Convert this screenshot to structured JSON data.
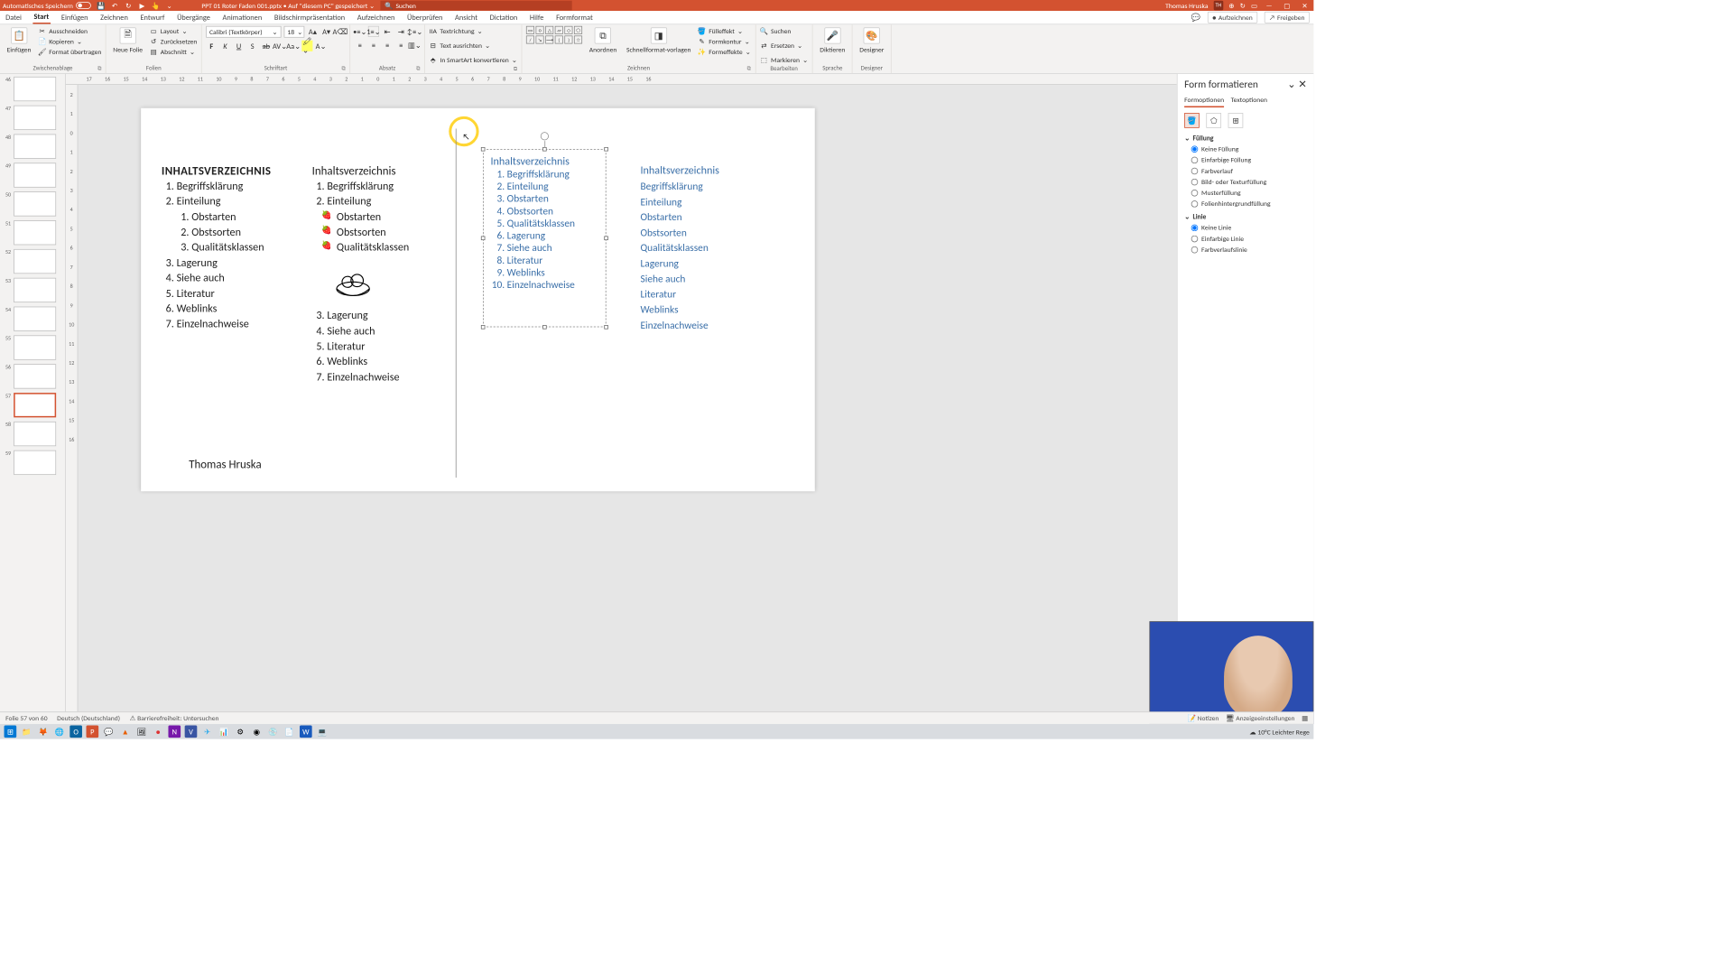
{
  "titlebar": {
    "autosave": "Automatisches Speichern",
    "filename": "PPT 01 Roter Faden 001.pptx • Auf \"diesem PC\" gespeichert ⌄",
    "search_placeholder": "Suchen",
    "user": "Thomas Hruska",
    "user_initials": "TH"
  },
  "tabs": {
    "datei": "Datei",
    "start": "Start",
    "einfuegen": "Einfügen",
    "zeichnen": "Zeichnen",
    "entwurf": "Entwurf",
    "uebergaenge": "Übergänge",
    "animationen": "Animationen",
    "praes": "Bildschirmpräsentation",
    "aufzeichnen": "Aufzeichnen",
    "ueberpruefen": "Überprüfen",
    "ansicht": "Ansicht",
    "dictation": "Dictation",
    "hilfe": "Hilfe",
    "formformat": "Formformat",
    "aufzeichnen_btn": "Aufzeichnen",
    "freigeben": "Freigeben"
  },
  "ribbon": {
    "einfuegen": "Einfügen",
    "ausschneiden": "Ausschneiden",
    "kopieren": "Kopieren",
    "format_uebertragen": "Format übertragen",
    "zwischenablage": "Zwischenablage",
    "neue_folie": "Neue Folie",
    "layout": "Layout",
    "zuruecksetzen": "Zurücksetzen",
    "abschnitt": "Abschnitt",
    "folien": "Folien",
    "font_name": "Calibri (Textkörper)",
    "font_size": "18",
    "schriftart": "Schriftart",
    "absatz": "Absatz",
    "textrichtung": "Textrichtung",
    "text_ausrichten": "Text ausrichten",
    "smartart": "In SmartArt konvertieren",
    "anordnen": "Anordnen",
    "schnellformat": "Schnellformat-vorlagen",
    "fuelleffekt": "Fülleffekt",
    "formkontur": "Formkontur",
    "formeffekte": "Formeffekte",
    "zeichnen": "Zeichnen",
    "suchen": "Suchen",
    "ersetzen": "Ersetzen",
    "markieren": "Markieren",
    "bearbeiten": "Bearbeiten",
    "diktieren": "Diktieren",
    "sprache": "Sprache",
    "designer": "Designer",
    "designer_grp": "Designer"
  },
  "thumbs": [
    "46",
    "47",
    "48",
    "49",
    "50",
    "51",
    "52",
    "53",
    "54",
    "55",
    "56",
    "57",
    "58",
    "59"
  ],
  "ruler_h": [
    "17",
    "16",
    "15",
    "14",
    "13",
    "12",
    "11",
    "10",
    "9",
    "8",
    "7",
    "6",
    "5",
    "4",
    "3",
    "2",
    "1",
    "0",
    "1",
    "2",
    "3",
    "4",
    "5",
    "6",
    "7",
    "8",
    "9",
    "10",
    "11",
    "12",
    "13",
    "14",
    "15",
    "16"
  ],
  "ruler_v": [
    "2",
    "1",
    "0",
    "1",
    "2",
    "3",
    "4",
    "5",
    "6",
    "7",
    "8",
    "9",
    "10",
    "11",
    "12",
    "13",
    "14",
    "15",
    "16"
  ],
  "slide": {
    "col1_title": "INHALTSVERZEICHNIS",
    "items": [
      "Begriffsklärung",
      "Einteilung"
    ],
    "sub": [
      "Obstarten",
      "Obstsorten",
      "Qualitätsklassen"
    ],
    "rest": [
      "Lagerung",
      "Siehe auch",
      "Literatur",
      "Weblinks",
      "Einzelnachweise"
    ],
    "col2_title": "Inhaltsverzeichnis",
    "col3_title": "Inhaltsverzeichnis",
    "col3_items": [
      "Begriffsklärung",
      "Einteilung",
      "Obstarten",
      "Obstsorten",
      "Qualitätsklassen",
      "Lagerung",
      "Siehe auch",
      "Literatur",
      "Weblinks",
      "Einzelnachweise"
    ],
    "col4_title": "Inhaltsverzeichnis",
    "col4_items": [
      "Begriffsklärung",
      "Einteilung",
      "Obstarten",
      "Obstsorten",
      "Qualitätsklassen",
      "Lagerung",
      "Siehe auch",
      "Literatur",
      "Weblinks",
      "Einzelnachweise"
    ],
    "author": "Thomas Hruska"
  },
  "pane": {
    "title": "Form formatieren",
    "formoptionen": "Formoptionen",
    "textoptionen": "Textoptionen",
    "fuellung": "Füllung",
    "keine_fuellung": "Keine Füllung",
    "einfarbige_fuellung": "Einfarbige Füllung",
    "farbverlauf": "Farbverlauf",
    "bild_textur": "Bild- oder Texturfüllung",
    "musterfuellung": "Musterfüllung",
    "folienhintergrund": "Folienhintergrundfüllung",
    "linie": "Linie",
    "keine_linie": "Keine Linie",
    "einfarbige_linie": "Einfarbige Linie",
    "farbverlaufslinie": "Farbverlaufslinie"
  },
  "status": {
    "folie": "Folie 57 von 60",
    "lang": "Deutsch (Deutschland)",
    "access": "Barrierefreiheit: Untersuchen",
    "notizen": "Notizen",
    "anzeige": "Anzeigeeinstellungen"
  },
  "taskbar": {
    "weather": "10°C  Leichter Rege"
  }
}
